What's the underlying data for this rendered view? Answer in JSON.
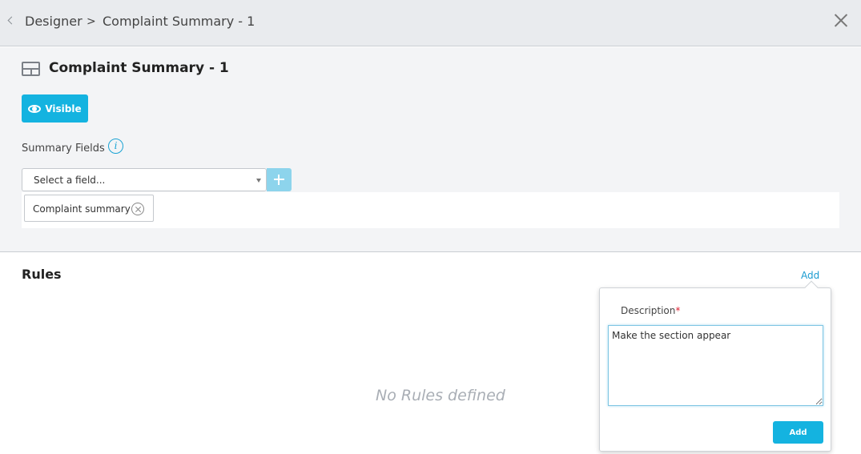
{
  "header": {
    "breadcrumb": {
      "home": "Designer",
      "separator": ">",
      "current": "Complaint Summary - 1"
    },
    "icons": {
      "back": "chevron-left-icon",
      "close": "close-icon"
    }
  },
  "section": {
    "icon": "section-layout-icon",
    "title": "Complaint Summary - 1",
    "visible_button": {
      "label": "Visible",
      "icon": "eye-icon",
      "color": "#14b3e0"
    }
  },
  "summary_fields": {
    "label": "Summary Fields",
    "info_icon": "info-icon",
    "select": {
      "value": "Select a field..."
    },
    "add_icon": "plus-icon",
    "tags": [
      {
        "label": "Complaint summary",
        "remove_icon": "circle-x-icon"
      }
    ]
  },
  "rules": {
    "title": "Rules",
    "add_link": "Add",
    "empty_message": "No Rules defined"
  },
  "rule_popover": {
    "description_label": "Description",
    "required_marker": "*",
    "description_value": "Make the section appear",
    "add_button": "Add"
  },
  "colors": {
    "accent": "#14b3e0",
    "link": "#1a9bd0",
    "header_bg": "#e9ebee",
    "panel_bg": "#f3f4f6"
  }
}
